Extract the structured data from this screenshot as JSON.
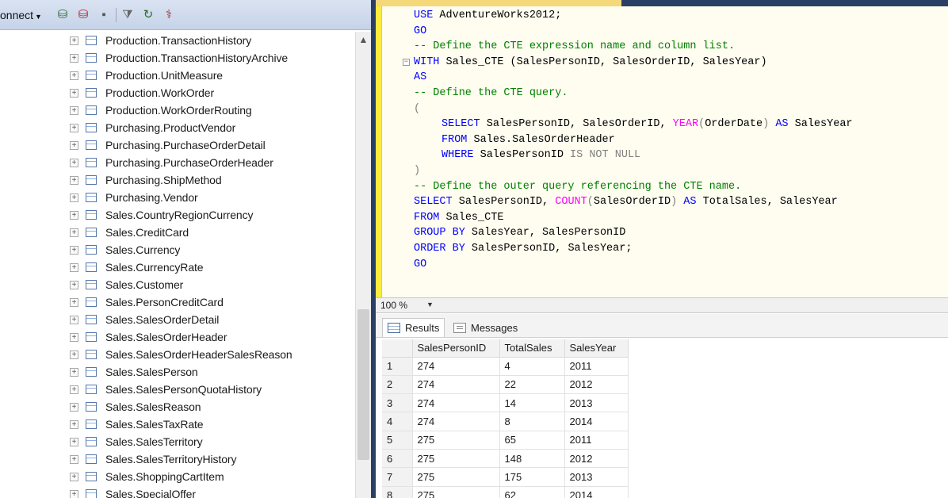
{
  "explorer": {
    "connect_label": "onnect",
    "items": [
      "Production.TransactionHistory",
      "Production.TransactionHistoryArchive",
      "Production.UnitMeasure",
      "Production.WorkOrder",
      "Production.WorkOrderRouting",
      "Purchasing.ProductVendor",
      "Purchasing.PurchaseOrderDetail",
      "Purchasing.PurchaseOrderHeader",
      "Purchasing.ShipMethod",
      "Purchasing.Vendor",
      "Sales.CountryRegionCurrency",
      "Sales.CreditCard",
      "Sales.Currency",
      "Sales.CurrencyRate",
      "Sales.Customer",
      "Sales.PersonCreditCard",
      "Sales.SalesOrderDetail",
      "Sales.SalesOrderHeader",
      "Sales.SalesOrderHeaderSalesReason",
      "Sales.SalesPerson",
      "Sales.SalesPersonQuotaHistory",
      "Sales.SalesReason",
      "Sales.SalesTaxRate",
      "Sales.SalesTerritory",
      "Sales.SalesTerritoryHistory",
      "Sales.ShoppingCartItem",
      "Sales.SpecialOffer"
    ],
    "expander_glyph": "+"
  },
  "editor": {
    "lines": [
      {
        "indent": false,
        "collapse": "",
        "tokens": [
          {
            "c": "kw",
            "t": "USE "
          },
          {
            "c": "tx",
            "t": "AdventureWorks2012;"
          }
        ]
      },
      {
        "indent": false,
        "collapse": "",
        "tokens": [
          {
            "c": "kw",
            "t": "GO"
          }
        ]
      },
      {
        "indent": false,
        "collapse": "",
        "tokens": [
          {
            "c": "cm",
            "t": "-- Define the CTE expression name and column list."
          }
        ]
      },
      {
        "indent": false,
        "collapse": "−",
        "tokens": [
          {
            "c": "kw",
            "t": "WITH "
          },
          {
            "c": "tx",
            "t": "Sales_CTE (SalesPersonID, SalesOrderID, SalesYear)"
          }
        ]
      },
      {
        "indent": false,
        "collapse": "",
        "tokens": [
          {
            "c": "kw",
            "t": "AS"
          }
        ]
      },
      {
        "indent": false,
        "collapse": "",
        "tokens": [
          {
            "c": "cm",
            "t": "-- Define the CTE query."
          }
        ]
      },
      {
        "indent": false,
        "collapse": "",
        "tokens": [
          {
            "c": "gr",
            "t": "("
          }
        ]
      },
      {
        "indent": true,
        "collapse": "",
        "tokens": [
          {
            "c": "kw",
            "t": "SELECT "
          },
          {
            "c": "tx",
            "t": "SalesPersonID, SalesOrderID, "
          },
          {
            "c": "fn",
            "t": "YEAR"
          },
          {
            "c": "gr",
            "t": "("
          },
          {
            "c": "tx",
            "t": "OrderDate"
          },
          {
            "c": "gr",
            "t": ") "
          },
          {
            "c": "kw",
            "t": "AS "
          },
          {
            "c": "tx",
            "t": "SalesYear"
          }
        ]
      },
      {
        "indent": true,
        "collapse": "",
        "tokens": [
          {
            "c": "kw",
            "t": "FROM "
          },
          {
            "c": "tx",
            "t": "Sales.SalesOrderHeader"
          }
        ]
      },
      {
        "indent": true,
        "collapse": "",
        "tokens": [
          {
            "c": "kw",
            "t": "WHERE "
          },
          {
            "c": "tx",
            "t": "SalesPersonID "
          },
          {
            "c": "gr",
            "t": "IS NOT NULL"
          }
        ]
      },
      {
        "indent": false,
        "collapse": "",
        "tokens": [
          {
            "c": "gr",
            "t": ")"
          }
        ]
      },
      {
        "indent": false,
        "collapse": "",
        "tokens": [
          {
            "c": "cm",
            "t": "-- Define the outer query referencing the CTE name."
          }
        ]
      },
      {
        "indent": false,
        "collapse": "",
        "tokens": [
          {
            "c": "kw",
            "t": "SELECT "
          },
          {
            "c": "tx",
            "t": "SalesPersonID, "
          },
          {
            "c": "fn",
            "t": "COUNT"
          },
          {
            "c": "gr",
            "t": "("
          },
          {
            "c": "tx",
            "t": "SalesOrderID"
          },
          {
            "c": "gr",
            "t": ") "
          },
          {
            "c": "kw",
            "t": "AS "
          },
          {
            "c": "tx",
            "t": "TotalSales, SalesYear"
          }
        ]
      },
      {
        "indent": false,
        "collapse": "",
        "tokens": [
          {
            "c": "kw",
            "t": "FROM "
          },
          {
            "c": "tx",
            "t": "Sales_CTE"
          }
        ]
      },
      {
        "indent": false,
        "collapse": "",
        "tokens": [
          {
            "c": "kw",
            "t": "GROUP BY "
          },
          {
            "c": "tx",
            "t": "SalesYear, SalesPersonID"
          }
        ]
      },
      {
        "indent": false,
        "collapse": "",
        "tokens": [
          {
            "c": "kw",
            "t": "ORDER BY "
          },
          {
            "c": "tx",
            "t": "SalesPersonID, SalesYear;"
          }
        ]
      },
      {
        "indent": false,
        "collapse": "",
        "tokens": [
          {
            "c": "kw",
            "t": "GO"
          }
        ]
      }
    ]
  },
  "zoom": {
    "value": "100 %",
    "arrow": "▼"
  },
  "results": {
    "tabs": [
      {
        "label": "Results",
        "active": true,
        "icon": "grid-icon"
      },
      {
        "label": "Messages",
        "active": false,
        "icon": "messages-icon"
      }
    ],
    "columns": [
      "SalesPersonID",
      "TotalSales",
      "SalesYear"
    ],
    "rows": [
      {
        "n": "1",
        "cells": [
          "274",
          "4",
          "2011"
        ]
      },
      {
        "n": "2",
        "cells": [
          "274",
          "22",
          "2012"
        ]
      },
      {
        "n": "3",
        "cells": [
          "274",
          "14",
          "2013"
        ]
      },
      {
        "n": "4",
        "cells": [
          "274",
          "8",
          "2014"
        ]
      },
      {
        "n": "5",
        "cells": [
          "275",
          "65",
          "2011"
        ]
      },
      {
        "n": "6",
        "cells": [
          "275",
          "148",
          "2012"
        ]
      },
      {
        "n": "7",
        "cells": [
          "275",
          "175",
          "2013"
        ]
      },
      {
        "n": "8",
        "cells": [
          "275",
          "62",
          "2014"
        ]
      }
    ]
  },
  "colors": {
    "keyword": "#0000ff",
    "comment": "#008000",
    "function": "#ff00ff",
    "splitter": "#2b3f66",
    "editor_margin": "#ffeb3b"
  }
}
